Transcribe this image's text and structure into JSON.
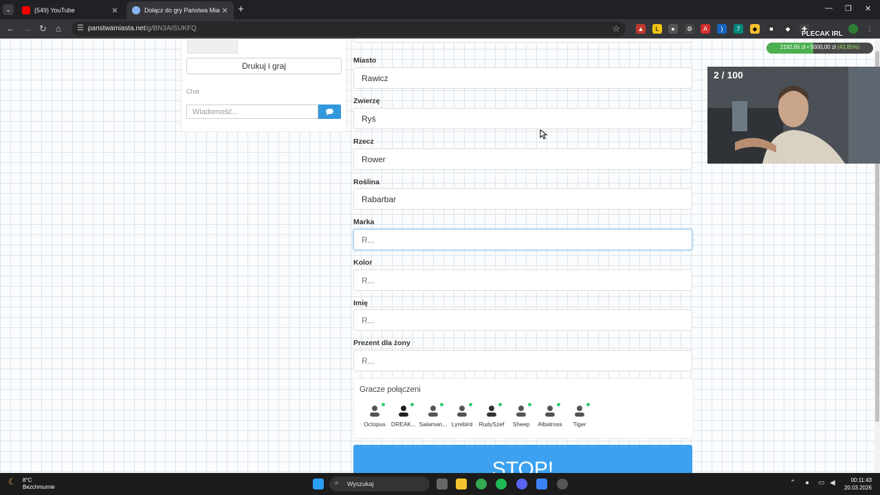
{
  "browser": {
    "tabs": [
      {
        "title": "(549) YouTube",
        "active": false,
        "favicon_color": "#ff0000"
      },
      {
        "title": "Dołącz do gry Państwa Miasta",
        "active": true,
        "favicon_color": "#8ab4f8"
      }
    ],
    "url_host": "panstwamiasta.net",
    "url_path": "/g/BN3AISUKFQ"
  },
  "left_panel": {
    "print_button": "Drukuj i graj",
    "chat_label": "Chat",
    "chat_placeholder": "Wiadomość..."
  },
  "form": {
    "fields": [
      {
        "label": "Miasto",
        "value": "Rawicz",
        "placeholder": ""
      },
      {
        "label": "Zwierzę",
        "value": "Ryś",
        "placeholder": ""
      },
      {
        "label": "Rzecz",
        "value": "Rower",
        "placeholder": ""
      },
      {
        "label": "Roślina",
        "value": "Rabarbar",
        "placeholder": ""
      },
      {
        "label": "Marka",
        "value": "",
        "placeholder": "R..."
      },
      {
        "label": "Kolor",
        "value": "",
        "placeholder": "R..."
      },
      {
        "label": "Imię",
        "value": "",
        "placeholder": "R..."
      },
      {
        "label": "Prezent dla żony",
        "value": "",
        "placeholder": "R..."
      }
    ],
    "players_title": "Gracze połączeni",
    "players": [
      "Octopus",
      "DREAK...",
      "Salaman...",
      "Lyrebird",
      "RudySzef",
      "Sheep",
      "Albatross",
      "Tiger"
    ],
    "stop_button": "STOP!"
  },
  "overlay": {
    "plecak": "PLECAK IRL",
    "money_text": "2192,65 zł • 5000,00 zł",
    "money_pct": "(43,85%)",
    "money_fraction": 0.4385,
    "counter": "2 / 100"
  },
  "taskbar": {
    "temp": "8°C",
    "weather": "Bezchmurnie",
    "search": "Wyszukaj",
    "time": "00:11:43",
    "date": "20.03.2026"
  }
}
